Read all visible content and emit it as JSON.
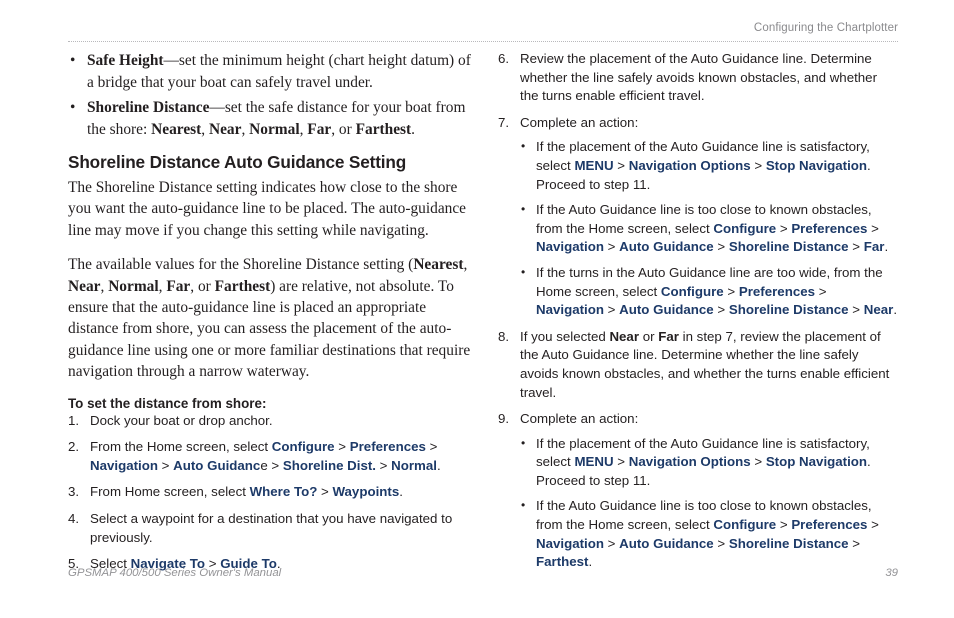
{
  "header": {
    "running_head": "Configuring the Chartplotter"
  },
  "footer": {
    "manual_title": "GPSMAP 400/500 Series Owner's Manual",
    "page_number": "39"
  },
  "colors": {
    "ui_term_blue": "#1d3a68",
    "body_text": "#231f20",
    "header_gray": "#8a8a8d",
    "footer_gray": "#939396",
    "rule_gray": "#b9b9bc"
  },
  "bullet_glyph": "•",
  "left_column": {
    "top_bullets": [
      [
        {
          "t": "Safe Height",
          "s": "b"
        },
        {
          "t": "—set the minimum height (chart height datum) of a bridge that your boat can safely travel under.",
          "s": ""
        }
      ],
      [
        {
          "t": "Shoreline Distance",
          "s": "b"
        },
        {
          "t": "—set the safe distance for your boat from the shore: ",
          "s": ""
        },
        {
          "t": "Nearest",
          "s": "b"
        },
        {
          "t": ", ",
          "s": ""
        },
        {
          "t": "Near",
          "s": "b"
        },
        {
          "t": ", ",
          "s": ""
        },
        {
          "t": "Normal",
          "s": "b"
        },
        {
          "t": ", ",
          "s": ""
        },
        {
          "t": "Far",
          "s": "b"
        },
        {
          "t": ", or ",
          "s": ""
        },
        {
          "t": "Farthest",
          "s": "b"
        },
        {
          "t": ".",
          "s": ""
        }
      ]
    ],
    "section_title": "Shoreline Distance Auto Guidance Setting",
    "paragraphs": [
      [
        {
          "t": "The Shoreline Distance setting indicates how close to the shore you want the auto-guidance line to be placed. The auto-guidance line may move if you change this setting while navigating.",
          "s": ""
        }
      ],
      [
        {
          "t": "The available values for the Shoreline Distance setting (",
          "s": ""
        },
        {
          "t": "Nearest",
          "s": "b"
        },
        {
          "t": ", ",
          "s": ""
        },
        {
          "t": "Near",
          "s": "b"
        },
        {
          "t": ", ",
          "s": ""
        },
        {
          "t": "Normal",
          "s": "b"
        },
        {
          "t": ", ",
          "s": ""
        },
        {
          "t": "Far",
          "s": "b"
        },
        {
          "t": ", or ",
          "s": ""
        },
        {
          "t": "Farthest",
          "s": "b"
        },
        {
          "t": ") are relative, not absolute. To ensure that the auto-guidance line is placed an appropriate distance from shore, you can assess the placement of the auto-guidance line using one or more familiar destinations that require navigation through a narrow waterway.",
          "s": ""
        }
      ]
    ],
    "sub_title": "To set the distance from shore:",
    "steps": [
      {
        "number": "1.",
        "text": [
          {
            "t": "Dock your boat or drop anchor.",
            "s": ""
          }
        ]
      },
      {
        "number": "2.",
        "text": [
          {
            "t": "From the Home screen, select ",
            "s": ""
          },
          {
            "t": "Configure",
            "s": "ui"
          },
          {
            "t": " > ",
            "s": ""
          },
          {
            "t": "Preferences",
            "s": "ui"
          },
          {
            "t": " > ",
            "s": ""
          },
          {
            "t": "Navigation",
            "s": "ui"
          },
          {
            "t": " > ",
            "s": ""
          },
          {
            "t": "Auto Guidanc",
            "s": "ui"
          },
          {
            "t": "e",
            "s": ""
          },
          {
            "t": " > ",
            "s": ""
          },
          {
            "t": "Shoreline Dist.",
            "s": "ui"
          },
          {
            "t": " > ",
            "s": ""
          },
          {
            "t": "Normal",
            "s": "ui"
          },
          {
            "t": ".",
            "s": ""
          }
        ]
      },
      {
        "number": "3.",
        "text": [
          {
            "t": "From Home screen, select ",
            "s": ""
          },
          {
            "t": "Where To?",
            "s": "ui"
          },
          {
            "t": " > ",
            "s": ""
          },
          {
            "t": "Waypoints",
            "s": "ui"
          },
          {
            "t": ".",
            "s": ""
          }
        ]
      },
      {
        "number": "4.",
        "text": [
          {
            "t": "Select a waypoint for a destination that you have navigated to previously.",
            "s": ""
          }
        ]
      },
      {
        "number": "5.",
        "text": [
          {
            "t": "Select ",
            "s": ""
          },
          {
            "t": "Navigate To",
            "s": "ui"
          },
          {
            "t": " > ",
            "s": ""
          },
          {
            "t": "Guide To",
            "s": "ui"
          },
          {
            "t": ".",
            "s": ""
          }
        ]
      }
    ]
  },
  "right_column": {
    "steps": [
      {
        "number": "6.",
        "text": [
          {
            "t": "Review the placement of the Auto Guidance line. Determine whether the line safely avoids known obstacles, and whether the turns enable efficient travel.",
            "s": ""
          }
        ],
        "subbullets": []
      },
      {
        "number": "7.",
        "text": [
          {
            "t": "Complete an action:",
            "s": ""
          }
        ],
        "subbullets": [
          [
            {
              "t": "If the placement of the Auto Guidance line is satisfactory, select ",
              "s": ""
            },
            {
              "t": "MENU",
              "s": "ui"
            },
            {
              "t": " > ",
              "s": ""
            },
            {
              "t": "Navigation Options",
              "s": "ui"
            },
            {
              "t": " > ",
              "s": ""
            },
            {
              "t": "Stop Navigation",
              "s": "ui"
            },
            {
              "t": ". Proceed to step 11.",
              "s": ""
            }
          ],
          [
            {
              "t": "If the Auto Guidance line is too close to known obstacles, from the Home screen, select ",
              "s": ""
            },
            {
              "t": "Configure",
              "s": "ui"
            },
            {
              "t": " > ",
              "s": ""
            },
            {
              "t": "Preferences",
              "s": "ui"
            },
            {
              "t": " > ",
              "s": ""
            },
            {
              "t": "Navigation",
              "s": "ui"
            },
            {
              "t": " > ",
              "s": ""
            },
            {
              "t": "Auto Guidance",
              "s": "ui"
            },
            {
              "t": " > ",
              "s": ""
            },
            {
              "t": "Shoreline Distance",
              "s": "ui"
            },
            {
              "t": " > ",
              "s": ""
            },
            {
              "t": "Far",
              "s": "ui"
            },
            {
              "t": ".",
              "s": ""
            }
          ],
          [
            {
              "t": "If the turns in the Auto Guidance line are too wide, from the Home screen, select ",
              "s": ""
            },
            {
              "t": "Configure",
              "s": "ui"
            },
            {
              "t": " > ",
              "s": ""
            },
            {
              "t": "Preferences",
              "s": "ui"
            },
            {
              "t": " > ",
              "s": ""
            },
            {
              "t": "Navigation",
              "s": "ui"
            },
            {
              "t": " > ",
              "s": ""
            },
            {
              "t": "Auto Guidance",
              "s": "ui"
            },
            {
              "t": " > ",
              "s": ""
            },
            {
              "t": "Shoreline Distance",
              "s": "ui"
            },
            {
              "t": " > ",
              "s": ""
            },
            {
              "t": "Near",
              "s": "ui"
            },
            {
              "t": ".",
              "s": ""
            }
          ]
        ]
      },
      {
        "number": "8.",
        "text": [
          {
            "t": "If you selected ",
            "s": ""
          },
          {
            "t": "Near",
            "s": "b"
          },
          {
            "t": " or ",
            "s": ""
          },
          {
            "t": "Far",
            "s": "b"
          },
          {
            "t": " in step 7, review the placement of the Auto Guidance line. Determine whether the line safely avoids known obstacles, and whether the turns enable efficient travel.",
            "s": ""
          }
        ],
        "subbullets": []
      },
      {
        "number": "9.",
        "text": [
          {
            "t": "Complete an action:",
            "s": ""
          }
        ],
        "subbullets": [
          [
            {
              "t": "If the placement of the Auto Guidance line is satisfactory, select ",
              "s": ""
            },
            {
              "t": "MENU",
              "s": "ui"
            },
            {
              "t": " > ",
              "s": ""
            },
            {
              "t": "Navigation Options",
              "s": "ui"
            },
            {
              "t": " > ",
              "s": ""
            },
            {
              "t": "Stop Navigation",
              "s": "ui"
            },
            {
              "t": ". Proceed to step 11.",
              "s": ""
            }
          ],
          [
            {
              "t": "If the Auto Guidance line is too close to known obstacles, from the Home screen, select ",
              "s": ""
            },
            {
              "t": "Configure",
              "s": "ui"
            },
            {
              "t": " > ",
              "s": ""
            },
            {
              "t": "Preferences",
              "s": "ui"
            },
            {
              "t": " > ",
              "s": ""
            },
            {
              "t": "Navigation",
              "s": "ui"
            },
            {
              "t": " > ",
              "s": ""
            },
            {
              "t": "Auto Guidance",
              "s": "ui"
            },
            {
              "t": " > ",
              "s": ""
            },
            {
              "t": "Shoreline Distance",
              "s": "ui"
            },
            {
              "t": " > ",
              "s": ""
            },
            {
              "t": "Farthest",
              "s": "ui"
            },
            {
              "t": ".",
              "s": ""
            }
          ]
        ]
      }
    ]
  }
}
